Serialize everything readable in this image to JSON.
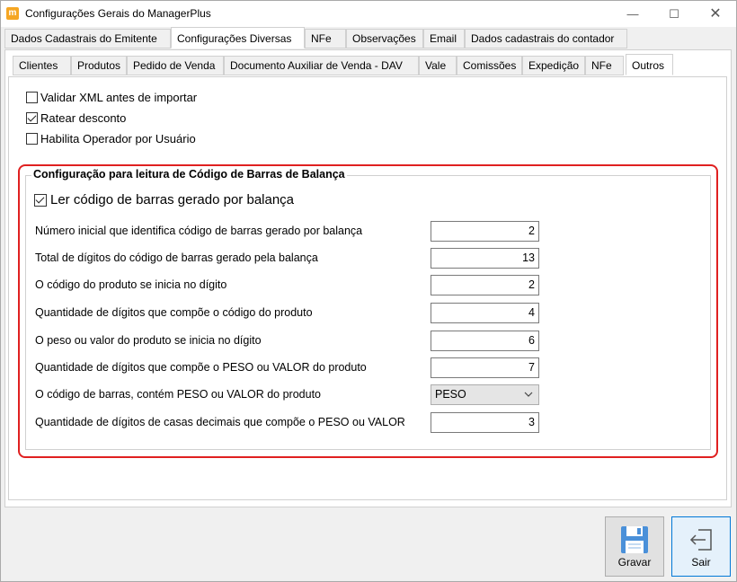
{
  "window": {
    "title": "Configurações Gerais do ManagerPlus",
    "app_icon": "m",
    "minimize": "—",
    "maximize": "☐",
    "close": "✕"
  },
  "main_tabs": [
    {
      "label": "Dados Cadastrais do Emitente",
      "active": false
    },
    {
      "label": "Configurações Diversas",
      "active": true
    },
    {
      "label": "NFe",
      "active": false
    },
    {
      "label": "Observações",
      "active": false
    },
    {
      "label": "Email",
      "active": false
    },
    {
      "label": "Dados cadastrais do contador",
      "active": false
    }
  ],
  "sub_tabs": [
    {
      "label": "Clientes",
      "active": false
    },
    {
      "label": "Produtos",
      "active": false
    },
    {
      "label": "Pedido de Venda",
      "active": false
    },
    {
      "label": "Documento Auxiliar de Venda - DAV",
      "active": false
    },
    {
      "label": "Vale",
      "active": false
    },
    {
      "label": "Comissões",
      "active": false
    },
    {
      "label": "Expedição",
      "active": false
    },
    {
      "label": "NFe",
      "active": false
    },
    {
      "label": "Outros",
      "active": true
    }
  ],
  "options": [
    {
      "label": "Validar XML antes de importar",
      "checked": false
    },
    {
      "label": "Ratear desconto",
      "checked": true
    },
    {
      "label": "Habilita Operador por Usuário",
      "checked": false
    }
  ],
  "barcode_group": {
    "title": "Configuração para leitura de Código de Barras de Balança",
    "enable_label": "Ler código de barras gerado por balança",
    "enable_checked": true,
    "fields": [
      {
        "label": "Número inicial que identifica código de barras gerado por balança",
        "value": "2"
      },
      {
        "label": "Total de dígitos do código de barras gerado pela balança",
        "value": "13"
      },
      {
        "label": "O código do produto se inicia no dígito",
        "value": "2"
      },
      {
        "label": "Quantidade de dígitos que compõe o código do produto",
        "value": "4"
      },
      {
        "label": "O peso ou valor do produto se inicia no dígito",
        "value": "6"
      },
      {
        "label": "Quantidade de dígitos que compõe o PESO ou VALOR do produto",
        "value": "7"
      }
    ],
    "select_field": {
      "label": "O código de barras, contém PESO ou VALOR do produto",
      "value": "PESO"
    },
    "decimal_field": {
      "label": "Quantidade de dígitos de casas decimais que compõe o PESO ou VALOR",
      "value": "3"
    }
  },
  "buttons": {
    "save_label": "Gravar",
    "exit_label": "Sair"
  },
  "colors": {
    "highlight_border": "#e02020",
    "focus_border": "#0078d7",
    "save_icon": "#4a90d9"
  },
  "icons": {
    "save": "floppy-disk-icon",
    "exit": "exit-arrow-icon",
    "dropdown": "chevron-down-icon"
  }
}
